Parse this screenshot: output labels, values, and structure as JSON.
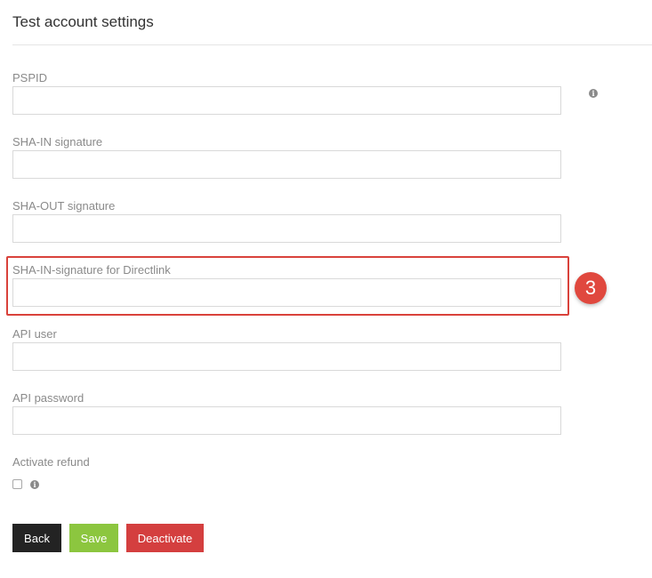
{
  "page": {
    "title": "Test account settings"
  },
  "form": {
    "pspid": {
      "label": "PSPID",
      "value": "",
      "info_icon": "info-icon"
    },
    "sha_in": {
      "label": "SHA-IN signature",
      "value": ""
    },
    "sha_out": {
      "label": "SHA-OUT signature",
      "value": ""
    },
    "sha_in_directlink": {
      "label": "SHA-IN-signature for Directlink",
      "value": ""
    },
    "api_user": {
      "label": "API user",
      "value": ""
    },
    "api_password": {
      "label": "API password",
      "value": ""
    },
    "activate_refund": {
      "label": "Activate refund",
      "checked": false,
      "info_icon": "info-icon"
    }
  },
  "annotation": {
    "step_number": "3",
    "highlight_color": "#d9423b"
  },
  "buttons": {
    "back": "Back",
    "save": "Save",
    "deactivate": "Deactivate"
  },
  "colors": {
    "back_button": "#232323",
    "save_button": "#8cc63f",
    "deactivate_button": "#d43f3f",
    "step_badge": "#e0483e"
  }
}
